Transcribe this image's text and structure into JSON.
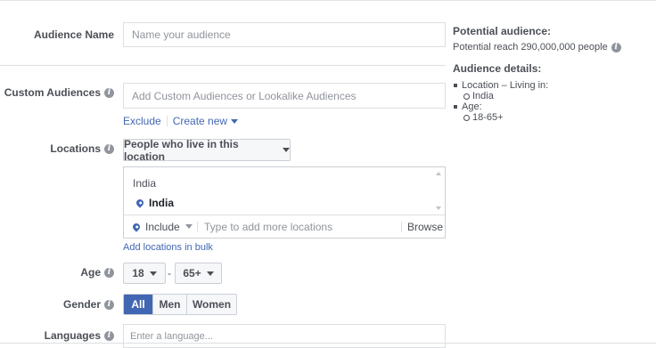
{
  "form": {
    "audience_name": {
      "label": "Audience Name",
      "placeholder": "Name your audience"
    },
    "custom_audiences": {
      "label": "Custom Audiences",
      "placeholder": "Add Custom Audiences or Lookalike Audiences",
      "exclude_link": "Exclude",
      "create_new_link": "Create new"
    },
    "locations": {
      "label": "Locations",
      "dropdown": "People who live in this location",
      "country_group": "India",
      "selected_location": "India",
      "include_label": "Include",
      "input_placeholder": "Type to add more locations",
      "browse_label": "Browse",
      "bulk_link": "Add locations in bulk"
    },
    "age": {
      "label": "Age",
      "min": "18",
      "max": "65+",
      "separator": "-"
    },
    "gender": {
      "label": "Gender",
      "options": [
        "All",
        "Men",
        "Women"
      ],
      "selected": "All"
    },
    "languages": {
      "label": "Languages",
      "placeholder": "Enter a language..."
    }
  },
  "sidebar": {
    "potential_title": "Potential audience:",
    "potential_reach": "Potential reach 290,000,000 people",
    "details_title": "Audience details:",
    "details": {
      "location_heading": "Location – Living in:",
      "location_value": "India",
      "age_heading": "Age:",
      "age_value": "18-65+"
    }
  },
  "icons": {
    "info": "info-icon",
    "dropdown": "chevron-down-icon",
    "location": "location-pin-icon"
  },
  "colors": {
    "accent": "#4267b2",
    "label": "#4b4f56",
    "placeholder": "#90949c",
    "border": "#dddfe2"
  }
}
